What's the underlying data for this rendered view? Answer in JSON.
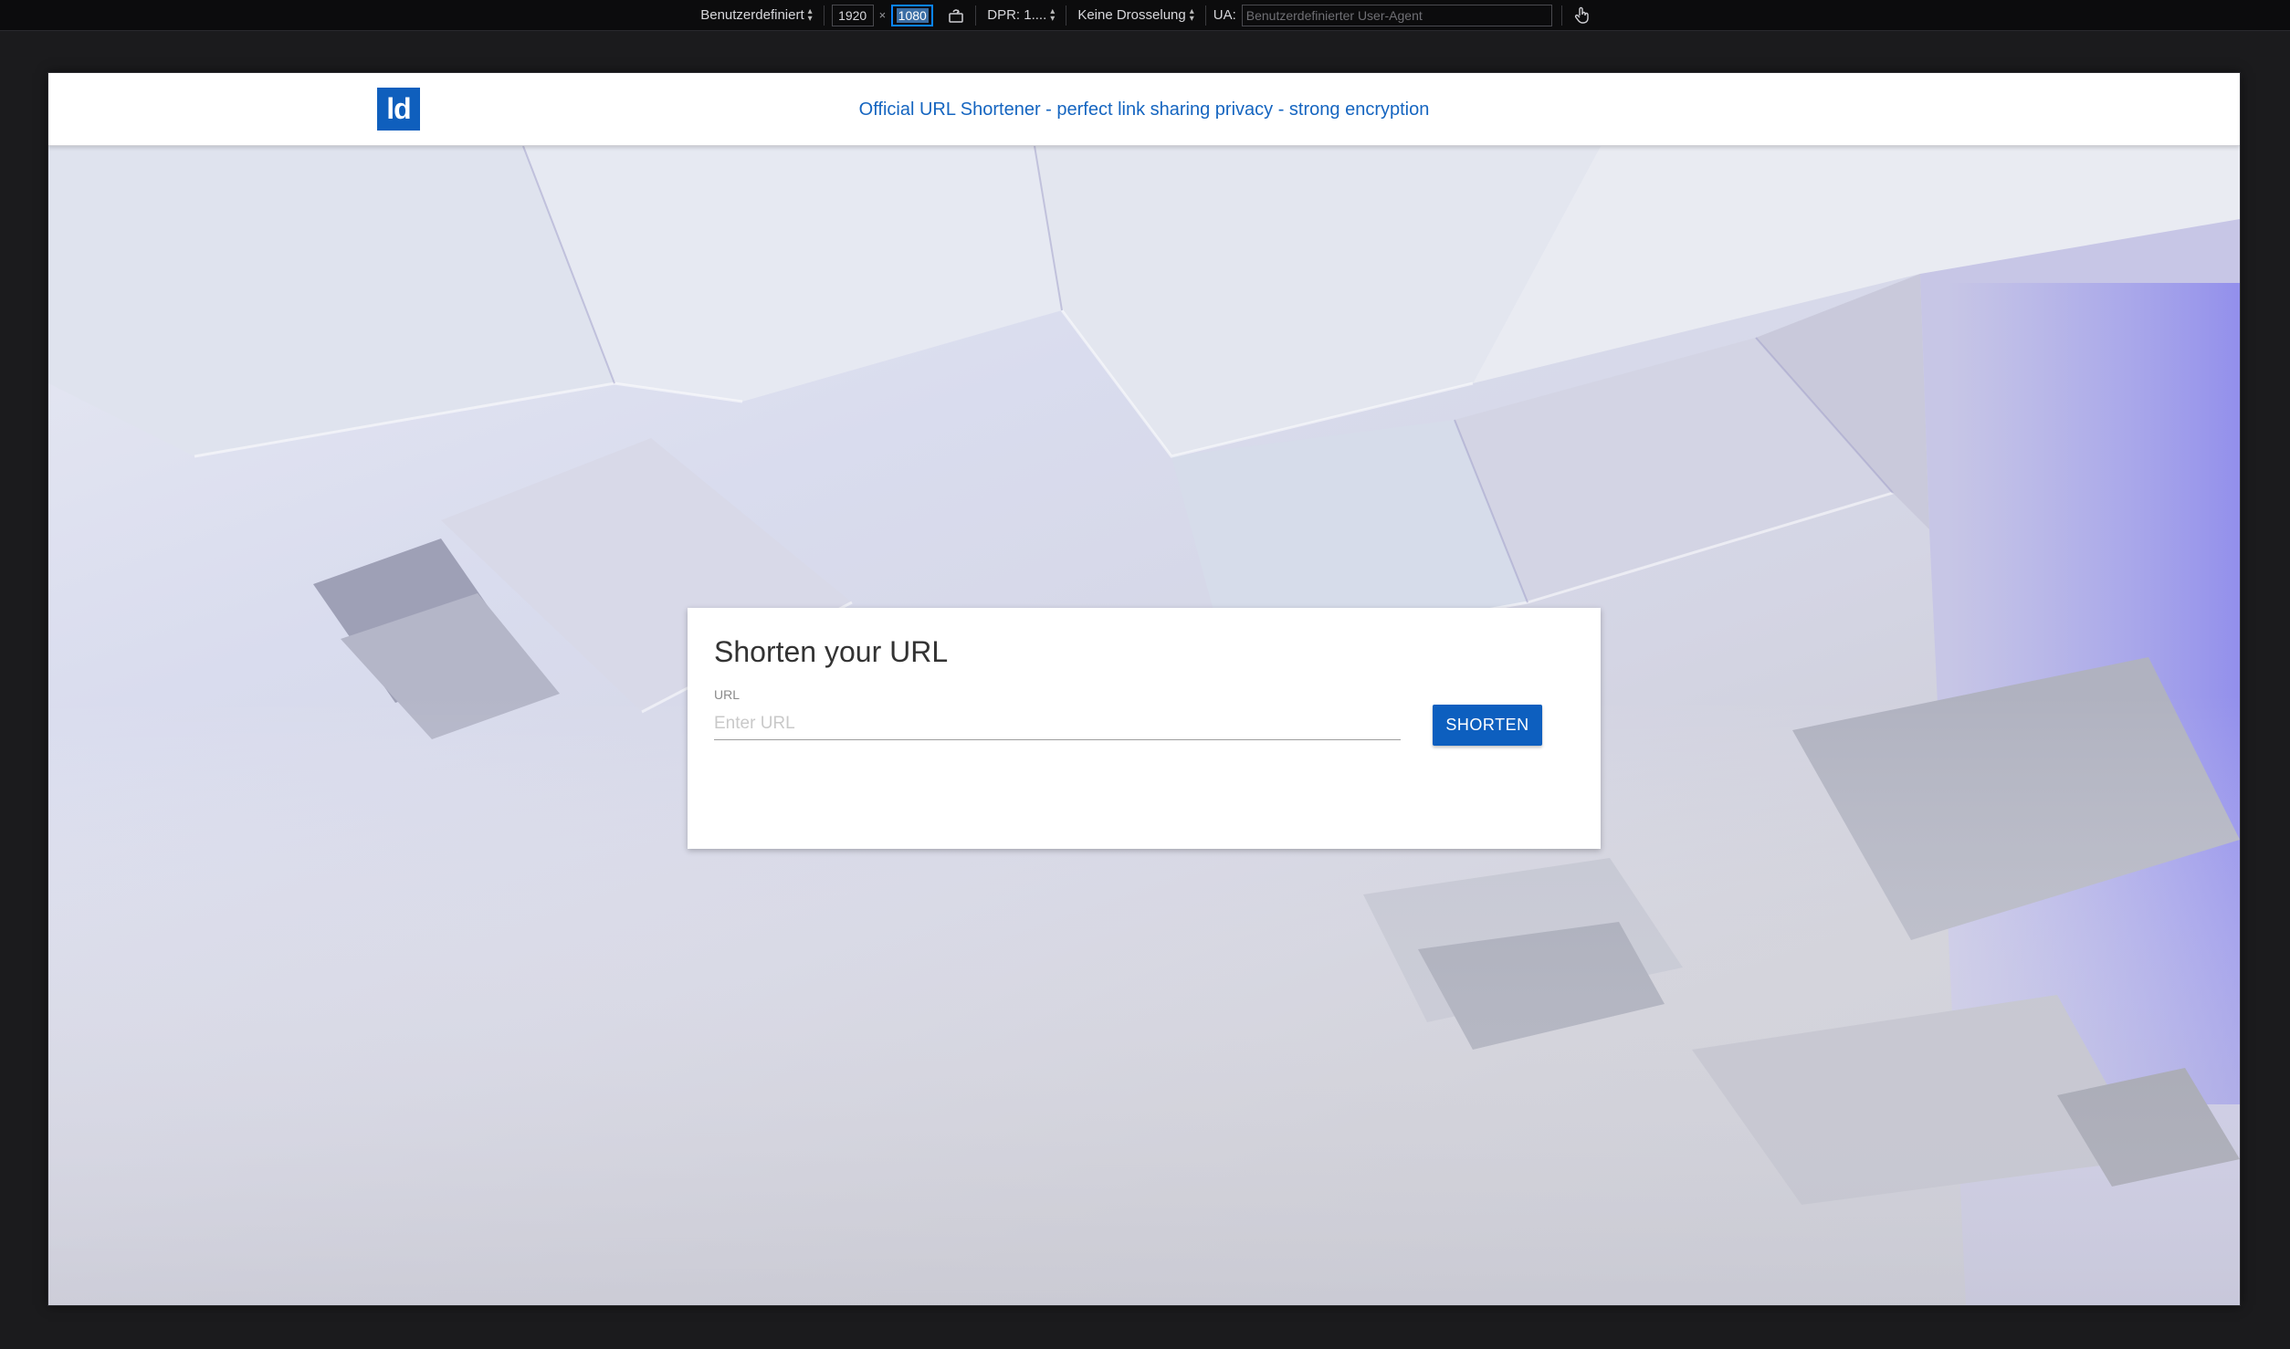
{
  "devtools": {
    "device_preset": "Benutzerdefiniert",
    "width": "1920",
    "times": "×",
    "height": "1080",
    "dpr": "DPR: 1....",
    "throttling": "Keine Drosselung",
    "ua_label": "UA:",
    "ua_placeholder": "Benutzerdefinierter User-Agent",
    "icons": {
      "rotate": "rotate-icon",
      "touch": "touch-icon"
    }
  },
  "site": {
    "logo_text": "ld",
    "tagline": "Official URL Shortener - perfect link sharing privacy - strong encryption",
    "brand_color": "#0f5fbd"
  },
  "card": {
    "title": "Shorten your URL",
    "url_label": "URL",
    "url_placeholder": "Enter URL",
    "url_value": "",
    "button_label": "SHORTEN"
  }
}
